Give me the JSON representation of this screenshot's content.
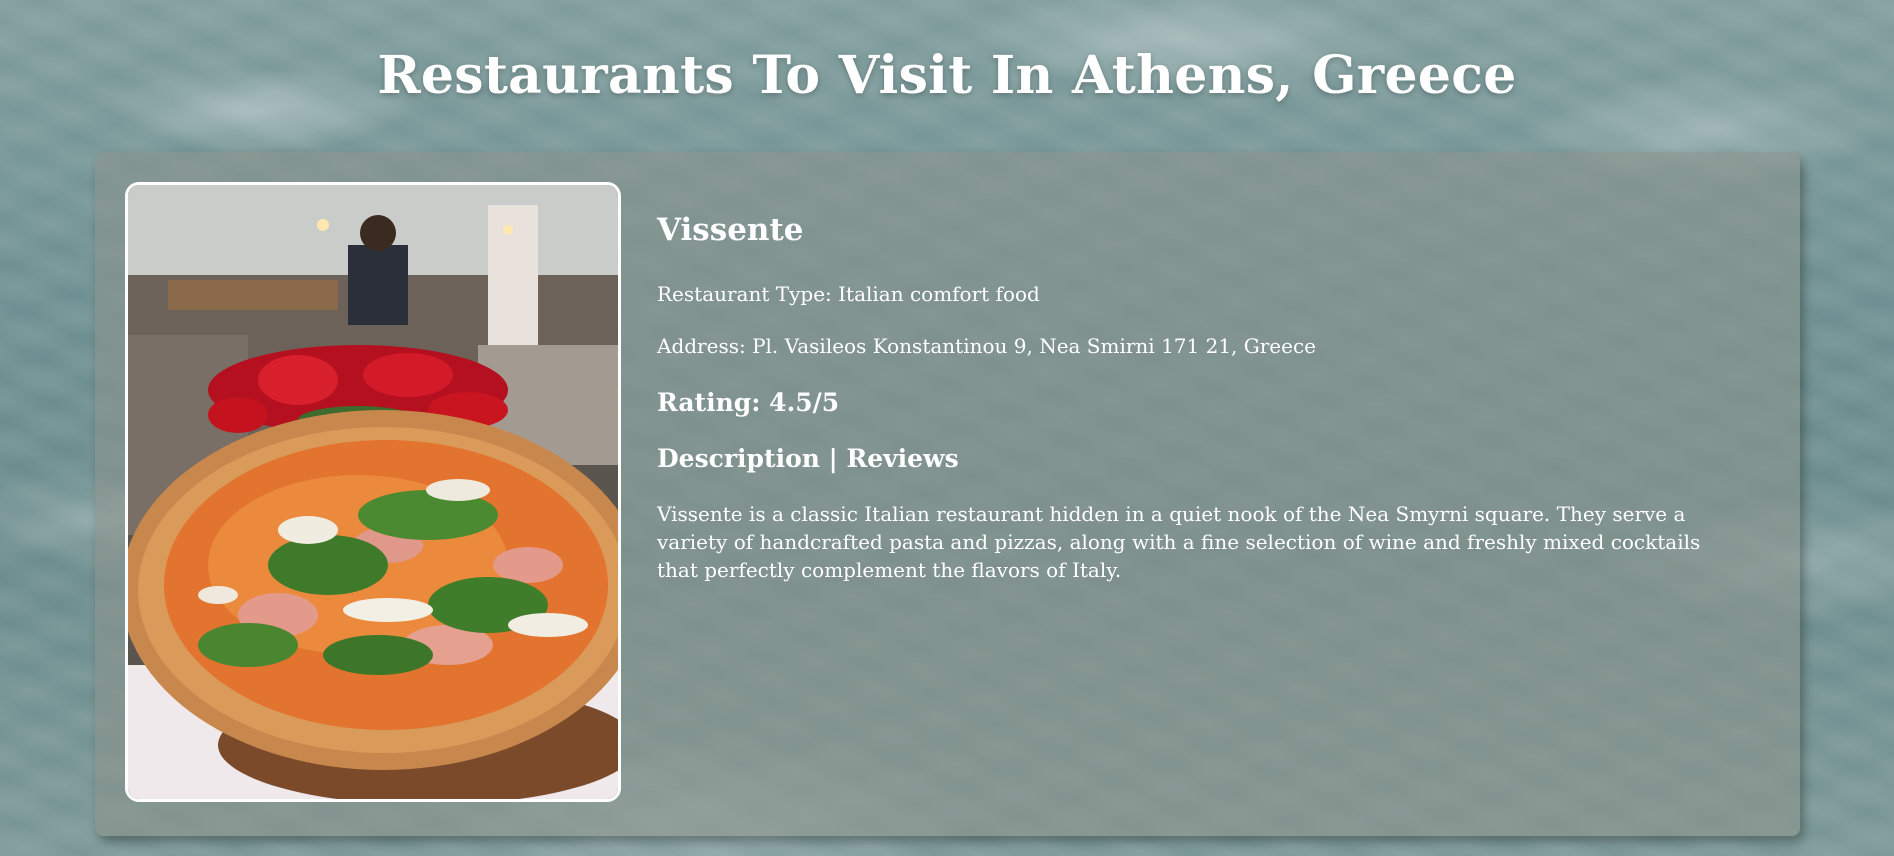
{
  "page": {
    "title": "Restaurants To Visit In Athens, Greece"
  },
  "restaurant": {
    "name": "Vissente",
    "type_line": "Restaurant Type: Italian comfort food",
    "address_line": "Address: Pl. Vasileos Konstantinou 9, Nea Smirni 171 21, Greece",
    "rating_line": "Rating: 4.5/5",
    "tabs": {
      "description": "Description",
      "separator": " | ",
      "reviews": "Reviews"
    },
    "description": "Vissente is a classic Italian restaurant hidden in a quiet nook of the Nea Smyrni square. They serve a variety of handcrafted pasta and pizzas, along with a fine selection of wine and freshly mixed cocktails that perfectly complement the flavors of Italy."
  }
}
